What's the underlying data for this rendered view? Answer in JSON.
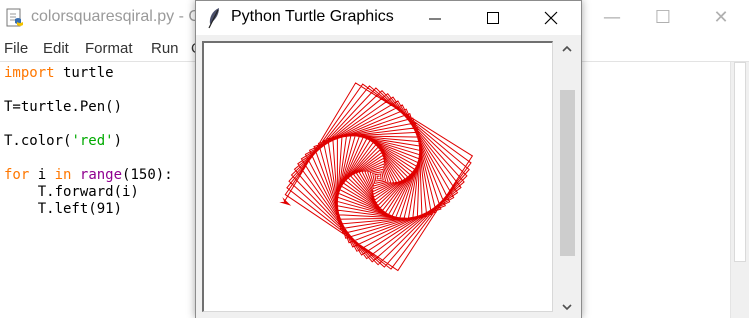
{
  "idle": {
    "title": "colorsquaresqiral.py - C",
    "controls": {
      "minimize": "—",
      "maximize": "☐",
      "close": "✕"
    },
    "menu": [
      "File",
      "Edit",
      "Format",
      "Run",
      "O"
    ],
    "code": {
      "l1_kw": "import",
      "l1_rest": " turtle",
      "l2": "T=turtle.Pen()",
      "l3_pre": "T.color(",
      "l3_str": "'red'",
      "l3_post": ")",
      "l4_kw1": "for",
      "l4_mid": " i ",
      "l4_kw2": "in",
      "l4_sp": " ",
      "l4_fn": "range",
      "l4_post": "(150):",
      "l5": "    T.forward(i)",
      "l6": "    T.left(91)"
    }
  },
  "turtle": {
    "title": "Python Turtle Graphics",
    "pen_color": "#e00000",
    "steps": 150,
    "turn_degrees": 91
  },
  "colors": {
    "keyword": "#ff7700",
    "builtin": "#900090",
    "string": "#00aa00"
  }
}
